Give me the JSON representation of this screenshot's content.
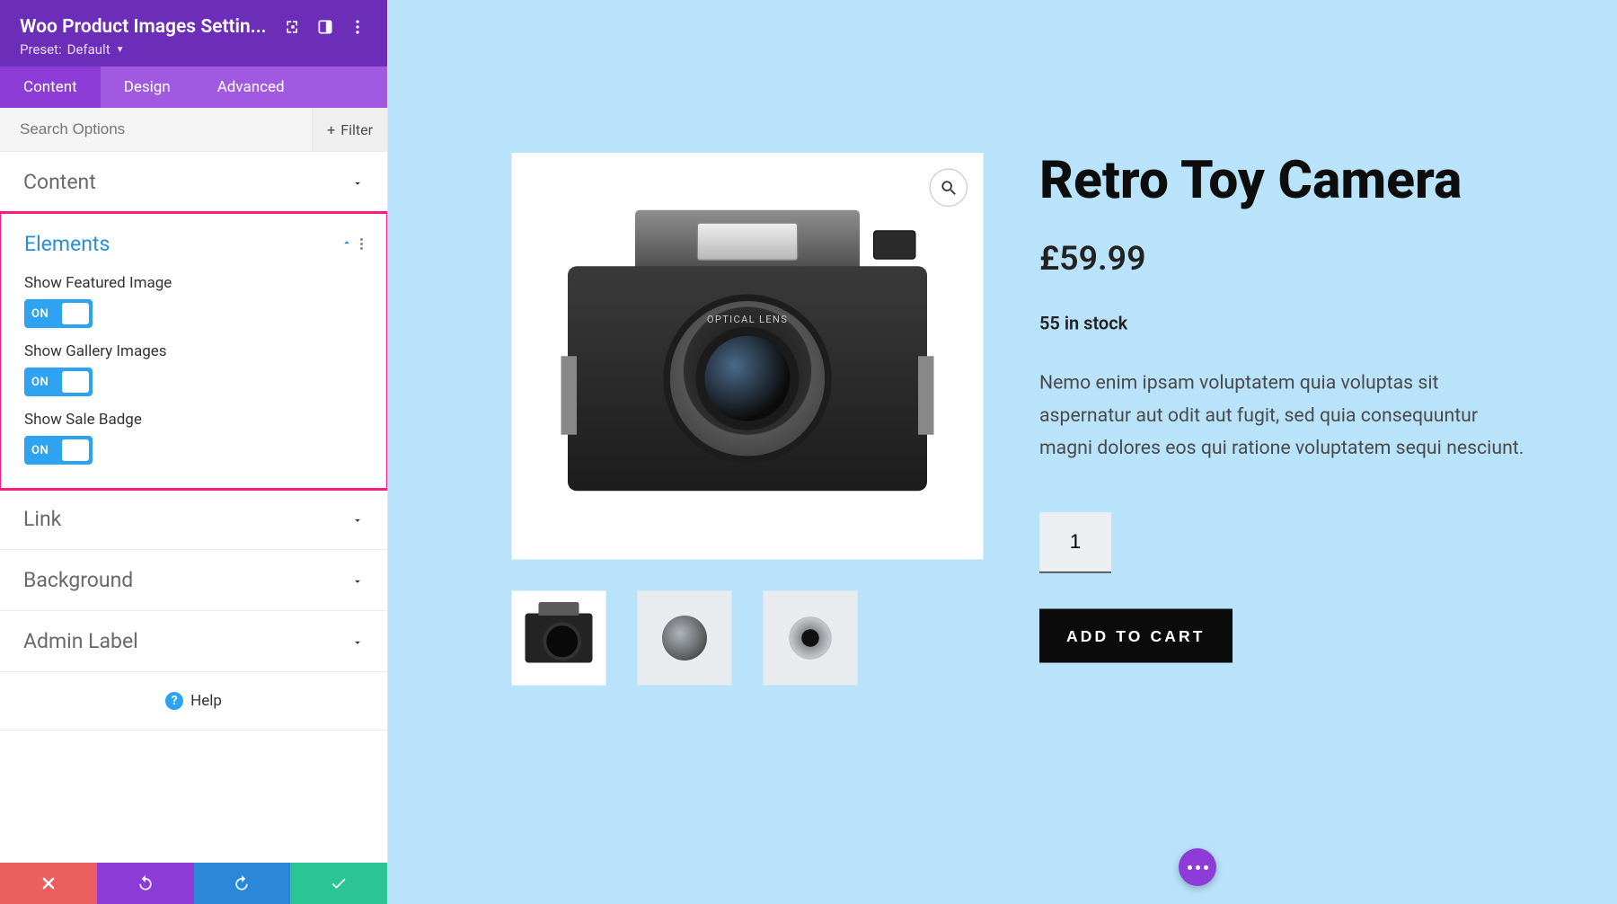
{
  "header": {
    "title": "Woo Product Images Settin...",
    "preset_prefix": "Preset:",
    "preset_value": "Default"
  },
  "tabs": {
    "content": "Content",
    "design": "Design",
    "advanced": "Advanced"
  },
  "search": {
    "placeholder": "Search Options",
    "filter_label": "Filter"
  },
  "sections": {
    "content": "Content",
    "elements": "Elements",
    "link": "Link",
    "background": "Background",
    "admin_label": "Admin Label"
  },
  "elements": {
    "featured": {
      "label": "Show Featured Image",
      "state": "ON"
    },
    "gallery": {
      "label": "Show Gallery Images",
      "state": "ON"
    },
    "sale": {
      "label": "Show Sale Badge",
      "state": "ON"
    }
  },
  "help_label": "Help",
  "product": {
    "title": "Retro Toy Camera",
    "price": "£59.99",
    "stock": "55 in stock",
    "description": "Nemo enim ipsam voluptatem quia voluptas sit aspernatur aut odit aut fugit, sed quia consequuntur magni dolores eos qui ratione voluptatem sequi nesciunt.",
    "qty": "1",
    "add_to_cart": "ADD TO CART",
    "lens_text": "OPTICAL LENS"
  }
}
